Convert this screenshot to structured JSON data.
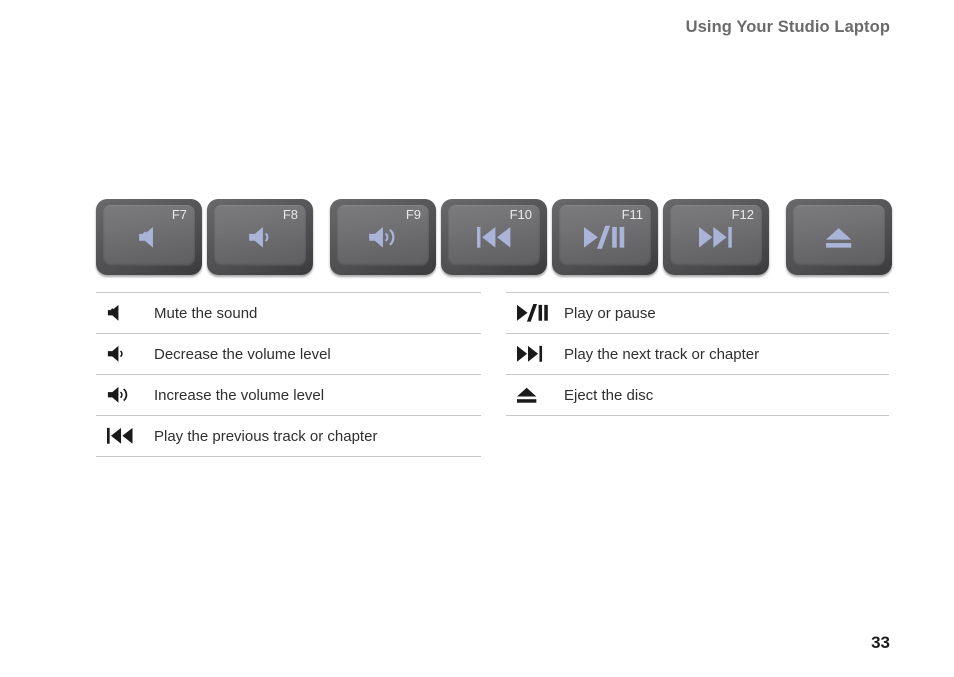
{
  "header": {
    "title": "Using Your Studio Laptop"
  },
  "colors": {
    "key_icon": "#aab4d8",
    "key_label": "#e9e9ec",
    "legend_icon": "#1a1a1a",
    "legend_text": "#2f2f2f",
    "header_text": "#6b6b6b",
    "divider": "#c9c9c9",
    "page_number": "#1c1c1c"
  },
  "keys": [
    {
      "label": "F7",
      "icon": "mute-icon"
    },
    {
      "label": "F8",
      "icon": "volume-down-icon"
    },
    {
      "label": "F9",
      "icon": "volume-up-icon"
    },
    {
      "label": "F10",
      "icon": "previous-track-icon"
    },
    {
      "label": "F11",
      "icon": "play-pause-icon"
    },
    {
      "label": "F12",
      "icon": "next-track-icon"
    },
    {
      "label": "",
      "icon": "eject-icon"
    }
  ],
  "legend_left": [
    {
      "icon": "mute-icon",
      "description": "Mute the sound"
    },
    {
      "icon": "volume-down-icon",
      "description": "Decrease the volume level"
    },
    {
      "icon": "volume-up-icon",
      "description": "Increase the volume level"
    },
    {
      "icon": "previous-track-icon",
      "description": "Play the previous track or chapter"
    }
  ],
  "legend_right": [
    {
      "icon": "play-pause-icon",
      "description": "Play or pause"
    },
    {
      "icon": "next-track-icon",
      "description": "Play the next track or chapter"
    },
    {
      "icon": "eject-icon",
      "description": "Eject the disc"
    }
  ],
  "footer": {
    "page_number": "33"
  }
}
